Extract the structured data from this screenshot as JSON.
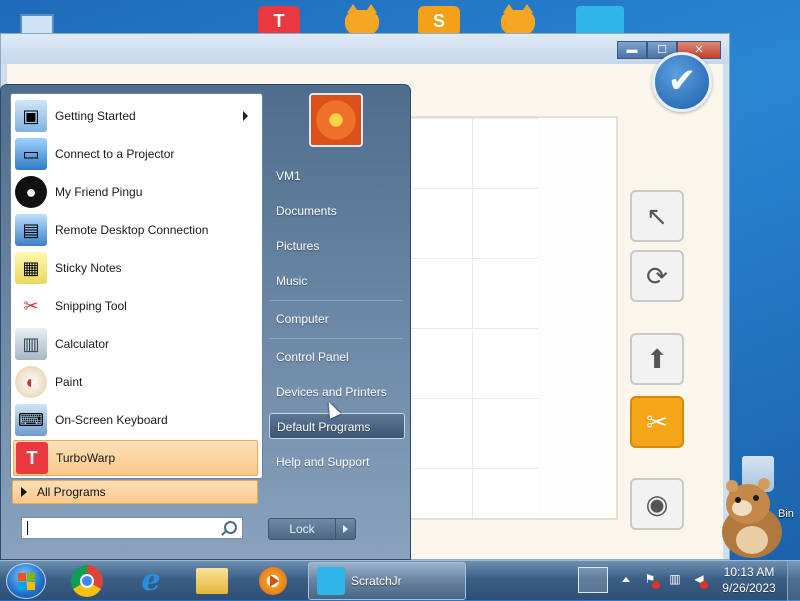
{
  "start_menu": {
    "programs": [
      {
        "label": "Getting Started",
        "icon": "getting-started-icon",
        "has_submenu": true
      },
      {
        "label": "Connect to a Projector",
        "icon": "projector-icon"
      },
      {
        "label": "My Friend Pingu",
        "icon": "pingu-icon"
      },
      {
        "label": "Remote Desktop Connection",
        "icon": "remote-desktop-icon"
      },
      {
        "label": "Sticky Notes",
        "icon": "sticky-notes-icon"
      },
      {
        "label": "Snipping Tool",
        "icon": "snipping-tool-icon"
      },
      {
        "label": "Calculator",
        "icon": "calculator-icon"
      },
      {
        "label": "Paint",
        "icon": "paint-icon"
      },
      {
        "label": "On-Screen Keyboard",
        "icon": "keyboard-icon"
      },
      {
        "label": "TurboWarp",
        "icon": "turbowarp-icon",
        "highlighted": true
      }
    ],
    "all_programs_label": "All Programs",
    "search_placeholder": "",
    "right_links": [
      {
        "label": "VM1"
      },
      {
        "label": "Documents"
      },
      {
        "label": "Pictures"
      },
      {
        "label": "Music"
      },
      {
        "label": "Computer"
      },
      {
        "label": "Control Panel"
      },
      {
        "label": "Devices and Printers"
      },
      {
        "label": "Default Programs",
        "highlighted": true
      },
      {
        "label": "Help and Support"
      }
    ],
    "lock_label": "Lock"
  },
  "desktop": {
    "recycle_bin_label": "Bin"
  },
  "taskbar": {
    "active_task_label": "ScratchJr",
    "time": "10:13 AM",
    "date": "9/26/2023"
  },
  "app_window": {
    "minimize_glyph": "▬",
    "maximize_glyph": "☐",
    "close_glyph": "✕",
    "check_glyph": "✔"
  },
  "colors": {
    "highlight": "#fbc98b",
    "start_menu_blue": "#4f6d8c",
    "scratchjr_orange": "#f5a518"
  }
}
